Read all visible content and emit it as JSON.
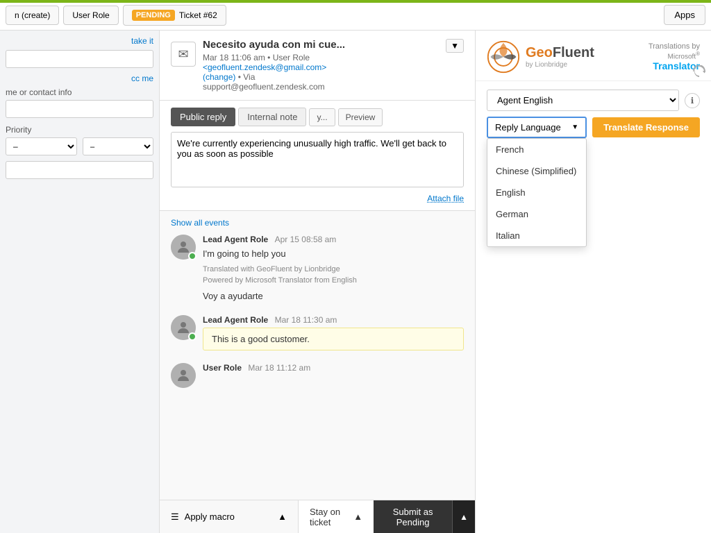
{
  "topBar": {
    "tab1": "n (create)",
    "tab2": "User Role",
    "pendingLabel": "PENDING",
    "ticketLabel": "Ticket #62",
    "appsBtn": "Apps"
  },
  "sidebar": {
    "takeIt": "take it",
    "ccMe": "cc me",
    "contactPlaceholder": "me or contact info",
    "priorityLabel": "Priority",
    "priorityValue": "–"
  },
  "ticket": {
    "subject": "Necesito ayuda con mi cue...",
    "meta": "Mar 18 11:06 am  •  User Role",
    "email": "<geofluent.zendesk@gmail.com>",
    "changeLink": "(change)",
    "via": " •  Via",
    "viaEmail": "support@geofluent.zendesk.com"
  },
  "replyArea": {
    "publicReplyTab": "Public reply",
    "internalNoteTab": "Internal note",
    "tab3": "y...",
    "previewTab": "Preview",
    "replyText": "We're currently experiencing unusually high traffic. We'll get back to you as soon as possible",
    "attachFile": "Attach file"
  },
  "events": {
    "showAllEvents": "Show all events",
    "event1": {
      "author": "Lead Agent Role",
      "time": "Apr 15 08:58 am",
      "text": "I'm going to help you",
      "translated1": "Translated with GeoFluent by Lionbridge",
      "translated2": "Powered by Microsoft Translator from English",
      "voy": "Voy a ayudarte"
    },
    "event2": {
      "author": "Lead Agent Role",
      "time": "Mar 18 11:30 am",
      "noteText": "This is a good customer."
    },
    "event3": {
      "author": "User Role",
      "time": "Mar 18 11:12 am"
    }
  },
  "bottomBar": {
    "applyMacro": "Apply macro",
    "stayOnTicket": "Stay on ticket",
    "submitAs": "Submit as Pending"
  },
  "geoFluent": {
    "logoGeo": "Geo",
    "logoFluent": "Fluent",
    "byLionbridge": "by Lionbridge",
    "translationsBy": "Translations by",
    "microsoftTranslator": "Microsoft® Translator",
    "agentLanguage": "Agent English",
    "replyLanguage": "Reply Language",
    "translateBtn": "Translate Response",
    "dropdown": {
      "selectedLabel": "Reply Language",
      "options": [
        "French",
        "Chinese (Simplified)",
        "English",
        "German",
        "Italian"
      ]
    }
  }
}
